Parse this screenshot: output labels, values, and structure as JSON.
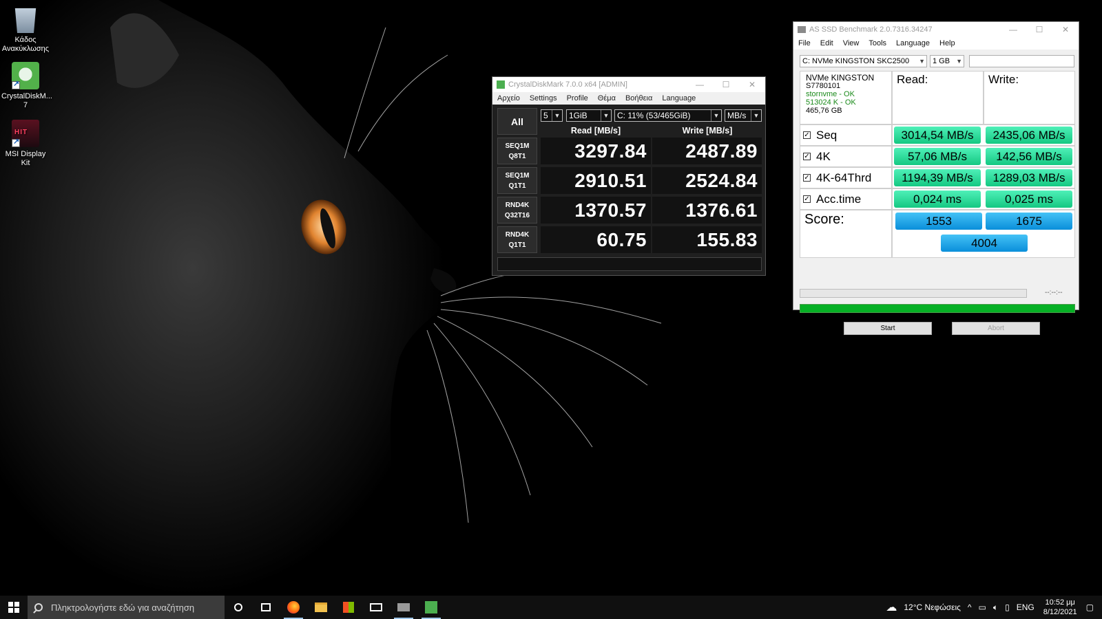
{
  "desktop": {
    "icons": [
      {
        "label": "Κάδος Ανακύκλωσης"
      },
      {
        "label": "CrystalDiskM... 7"
      },
      {
        "label": "MSI Display Kit"
      }
    ]
  },
  "cdm": {
    "title": "CrystalDiskMark 7.0.0 x64 [ADMIN]",
    "menu": [
      "Αρχείο",
      "Settings",
      "Profile",
      "Θέμα",
      "Βοήθεια",
      "Language"
    ],
    "all_label": "All",
    "count": "5",
    "size": "1GiB",
    "drive": "C: 11% (53/465GiB)",
    "unit": "MB/s",
    "read_header": "Read [MB/s]",
    "write_header": "Write [MB/s]",
    "rows": [
      {
        "line1": "SEQ1M",
        "line2": "Q8T1",
        "read": "3297.84",
        "write": "2487.89"
      },
      {
        "line1": "SEQ1M",
        "line2": "Q1T1",
        "read": "2910.51",
        "write": "2524.84"
      },
      {
        "line1": "RND4K",
        "line2": "Q32T16",
        "read": "1370.57",
        "write": "1376.61"
      },
      {
        "line1": "RND4K",
        "line2": "Q1T1",
        "read": "60.75",
        "write": "155.83"
      }
    ]
  },
  "asssd": {
    "title": "AS SSD Benchmark 2.0.7316.34247",
    "menu": [
      "File",
      "Edit",
      "View",
      "Tools",
      "Language",
      "Help"
    ],
    "drive": "C: NVMe KINGSTON SKC2500",
    "size": "1 GB",
    "info": {
      "model": "NVMe KINGSTON",
      "fw": "S7780101",
      "driver": "stornvme - OK",
      "align": "513024 K - OK",
      "capacity": "465,76 GB"
    },
    "read_header": "Read:",
    "write_header": "Write:",
    "rows": [
      {
        "label": "Seq",
        "read": "3014,54 MB/s",
        "write": "2435,06 MB/s"
      },
      {
        "label": "4K",
        "read": "57,06 MB/s",
        "write": "142,56 MB/s"
      },
      {
        "label": "4K-64Thrd",
        "read": "1194,39 MB/s",
        "write": "1289,03 MB/s"
      },
      {
        "label": "Acc.time",
        "read": "0,024 ms",
        "write": "0,025 ms"
      }
    ],
    "score_label": "Score:",
    "score_read": "1553",
    "score_write": "1675",
    "score_total": "4004",
    "time": "--:--:--",
    "start_label": "Start",
    "abort_label": "Abort"
  },
  "taskbar": {
    "search_placeholder": "Πληκτρολογήστε εδώ για αναζήτηση",
    "weather": "12°C Νεφώσεις",
    "lang": "ENG",
    "time": "10:52 μμ",
    "date": "8/12/2021"
  },
  "colors": {
    "result_green": "#2ee6a0",
    "score_blue": "#1aa6ea",
    "progress_green": "#06b025",
    "cdm_background": "#1f1f1f"
  }
}
